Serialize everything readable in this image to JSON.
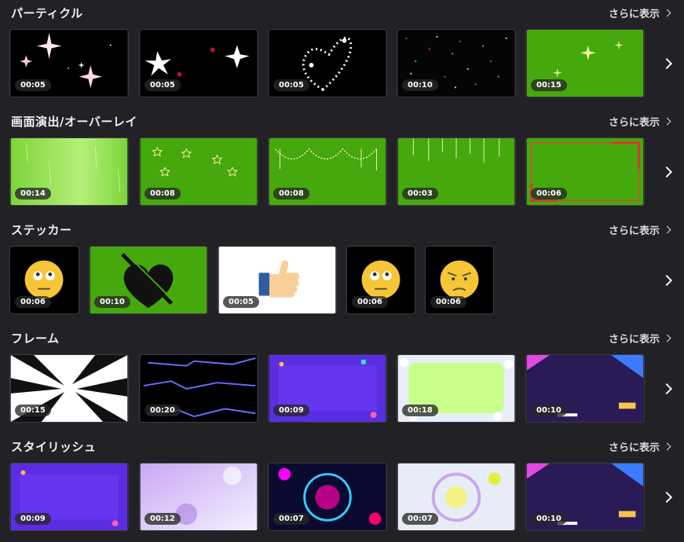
{
  "more_label": "さらに表示",
  "sections": [
    {
      "title": "パーティクル",
      "durations": [
        "00:05",
        "00:05",
        "00:05",
        "00:10",
        "00:15"
      ]
    },
    {
      "title": "画面演出/オーバーレイ",
      "durations": [
        "00:14",
        "00:08",
        "00:08",
        "00:03",
        "00:06"
      ]
    },
    {
      "title": "ステッカー",
      "durations": [
        "00:06",
        "00:10",
        "00:05",
        "00:06",
        "00:06"
      ]
    },
    {
      "title": "フレーム",
      "durations": [
        "00:15",
        "00:20",
        "00:09",
        "00:18",
        "00:10"
      ]
    },
    {
      "title": "スタイリッシュ",
      "durations": [
        "00:09",
        "00:12",
        "00:07",
        "00:07",
        "00:10"
      ]
    }
  ],
  "colors": {
    "background": "#222226",
    "green_screen": "#45a80c",
    "badge": "#3a3a3a"
  }
}
